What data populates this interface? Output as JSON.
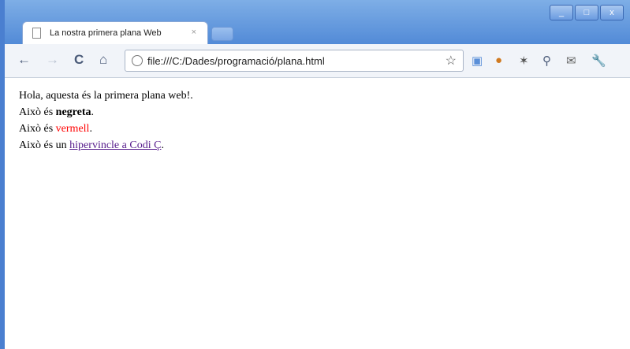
{
  "browser": {
    "tab_title": "La nostra primera plana Web",
    "tab_close": "×",
    "window_buttons": {
      "minimize": "_",
      "maximize": "□",
      "close": "x"
    },
    "address": "file:///C:/Dades/programació/plana.html"
  },
  "page": {
    "line1": "Hola, aquesta és la primera plana web!.",
    "line2_prefix": "Això és ",
    "line2_bold": "negreta",
    "line2_suffix": ".",
    "line3_prefix": "Això és ",
    "line3_red": "vermell",
    "line3_suffix": ".",
    "line4_prefix": "Això és un ",
    "line4_link": "hipervincle a Codi Ç",
    "line4_suffix": "."
  },
  "colors": {
    "red_text": "#ff0000",
    "link": "#551a8b",
    "chrome_blue": "#4f88d6"
  }
}
